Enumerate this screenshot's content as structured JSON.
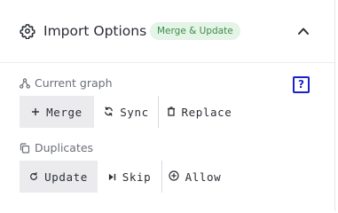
{
  "header": {
    "title": "Import Options",
    "badge": "Merge & Update",
    "icon": "gear-icon",
    "collapse_icon": "chevron-up-icon"
  },
  "current_graph": {
    "label": "Current graph",
    "icon": "graph-icon",
    "help_glyph": "?",
    "options": [
      {
        "label": "Merge",
        "icon": "plus-icon",
        "selected": true
      },
      {
        "label": "Sync",
        "icon": "sync-icon",
        "selected": false
      },
      {
        "label": "Replace",
        "icon": "trash-icon",
        "selected": false
      }
    ]
  },
  "duplicates": {
    "label": "Duplicates",
    "icon": "copy-icon",
    "options": [
      {
        "label": "Update",
        "icon": "refresh-icon",
        "selected": true
      },
      {
        "label": "Skip",
        "icon": "skip-icon",
        "selected": false
      },
      {
        "label": "Allow",
        "icon": "plus-circle-icon",
        "selected": false
      }
    ]
  },
  "colors": {
    "badge_bg": "#e4f4e6",
    "badge_text": "#3d8c4a",
    "help_icon": "#1b22c9",
    "selected_bg": "#ebebed"
  }
}
